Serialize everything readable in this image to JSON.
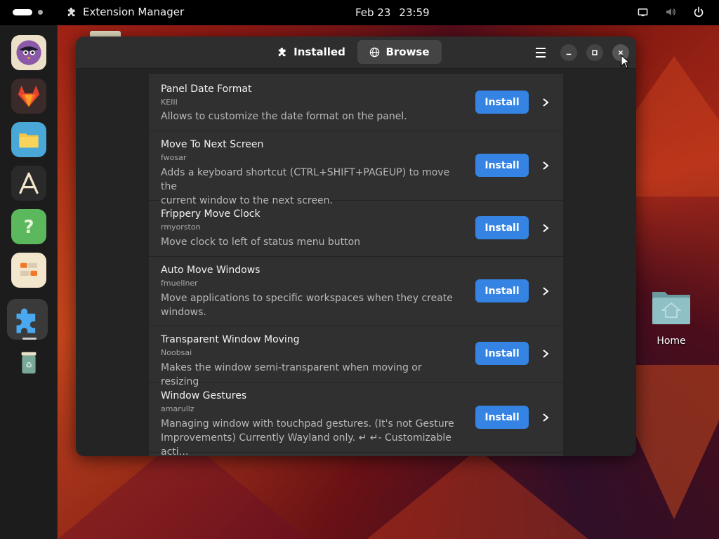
{
  "topbar": {
    "app_name": "Extension Manager",
    "date": "Feb 23",
    "time": "23:59"
  },
  "dock": {
    "items": [
      "whatsie",
      "gitlab",
      "files",
      "software",
      "help",
      "tweaks",
      "extension-manager",
      "trash"
    ]
  },
  "desktop": {
    "home_label": "Home"
  },
  "window": {
    "tabs": [
      {
        "label": "Installed",
        "icon": "puzzle-icon"
      },
      {
        "label": "Browse",
        "icon": "globe-icon",
        "active": true
      }
    ],
    "extensions": [
      {
        "name": "Panel Date Format",
        "author": "KEIII",
        "desc_lines": [
          "Allows to customize the date format on the panel."
        ],
        "button": "Install"
      },
      {
        "name": "Move To Next Screen",
        "author": "fwosar",
        "desc_lines": [
          "Adds a keyboard shortcut (CTRL+SHIFT+PAGEUP) to move the",
          "current window to the next screen."
        ],
        "button": "Install"
      },
      {
        "name": "Frippery Move Clock",
        "author": "rmyorston",
        "desc_lines": [
          "Move clock to left of status menu button"
        ],
        "button": "Install"
      },
      {
        "name": "Auto Move Windows",
        "author": "fmuellner",
        "desc_lines": [
          "Move applications to specific workspaces when they create",
          "windows."
        ],
        "button": "Install"
      },
      {
        "name": "Transparent Window Moving",
        "author": "Noobsai",
        "desc_lines": [
          "Makes the window semi-transparent when moving or resizing"
        ],
        "button": "Install"
      },
      {
        "name": "Window Gestures",
        "author": "amarullz",
        "desc_lines": [
          "Managing window with touchpad gestures. (It's not Gesture",
          "Improvements) Currently Wayland only. ↵ ↵- Customizable acti…"
        ],
        "button": "Install"
      }
    ]
  },
  "colors": {
    "accent": "#3584e4",
    "window_bg": "#242424",
    "row_bg": "#303030"
  }
}
